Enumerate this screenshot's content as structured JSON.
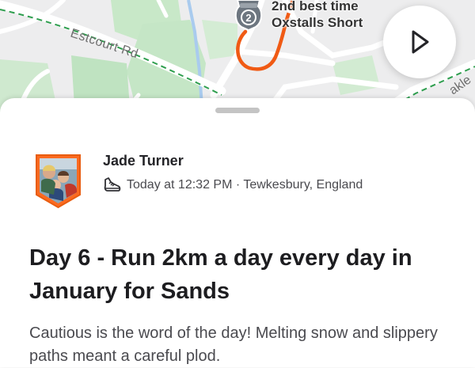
{
  "map": {
    "road_name": "Estcourt Rd",
    "road_name_2": "akle",
    "segment": {
      "rank_number": "2",
      "rank_text": "2nd best time",
      "segment_name": "Oxstalls Short"
    },
    "route_color": "#f05a14"
  },
  "activity": {
    "athlete_name": "Jade Turner",
    "meta": "Today at 12:32 PM · Tewkesbury, England",
    "title": "Day 6 - Run 2km a day every day in January for Sands",
    "description": "Cautious is the word of the day! Melting snow and slippery paths meant a careful plod."
  },
  "colors": {
    "accent": "#fc4c02",
    "park_green": "#c5e8c6",
    "map_background": "#ededee"
  }
}
